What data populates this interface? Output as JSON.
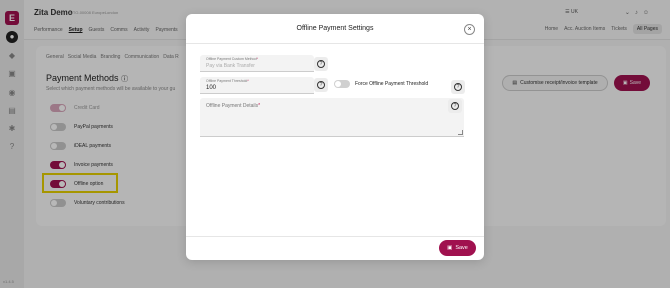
{
  "app": {
    "logo_letter": "E",
    "event_title": "Zita Demo",
    "event_code": "JUTO-00008 EuropeLondon",
    "version": "v1.4.5"
  },
  "header": {
    "tabs": [
      "Performance",
      "Setup",
      "Guests",
      "Comms",
      "Activity",
      "Payments"
    ],
    "active_tab": "Setup",
    "language": "UK",
    "crumbs": [
      "Home",
      "Acc. Auction Items",
      "Tickets"
    ],
    "all_pages_label": "All Pages"
  },
  "settings": {
    "subtabs": [
      "General",
      "Social Media",
      "Branding",
      "Communication",
      "Data R"
    ],
    "heading": "Payment Methods",
    "description": "Select which payment methods will be available to your gu",
    "customise_label": "Customise receipt/invoice template",
    "save_label": "Save",
    "methods": [
      {
        "label": "Credit Card",
        "state": "on-disabled"
      },
      {
        "label": "PayPal payments",
        "state": "off"
      },
      {
        "label": "iDEAL payments",
        "state": "off"
      },
      {
        "label": "Invoice payments",
        "state": "on"
      },
      {
        "label": "Offline option",
        "state": "on"
      },
      {
        "label": "Voluntary contributions",
        "state": "off"
      }
    ]
  },
  "modal": {
    "title": "Offline Payment Settings",
    "close_symbol": "×",
    "custom_method_label": "Offline Payment Custom Method",
    "custom_method_placeholder": "Pay via Bank Transfer",
    "threshold_label": "Offline Payment Threshold",
    "threshold_value": "100",
    "force_threshold_label": "Force Offline Payment Threshold",
    "details_label": "Offline Payment Details",
    "required_mark": "*",
    "save_label": "Save"
  },
  "colors": {
    "accent": "#a0114f",
    "highlight": "#e6d000"
  }
}
